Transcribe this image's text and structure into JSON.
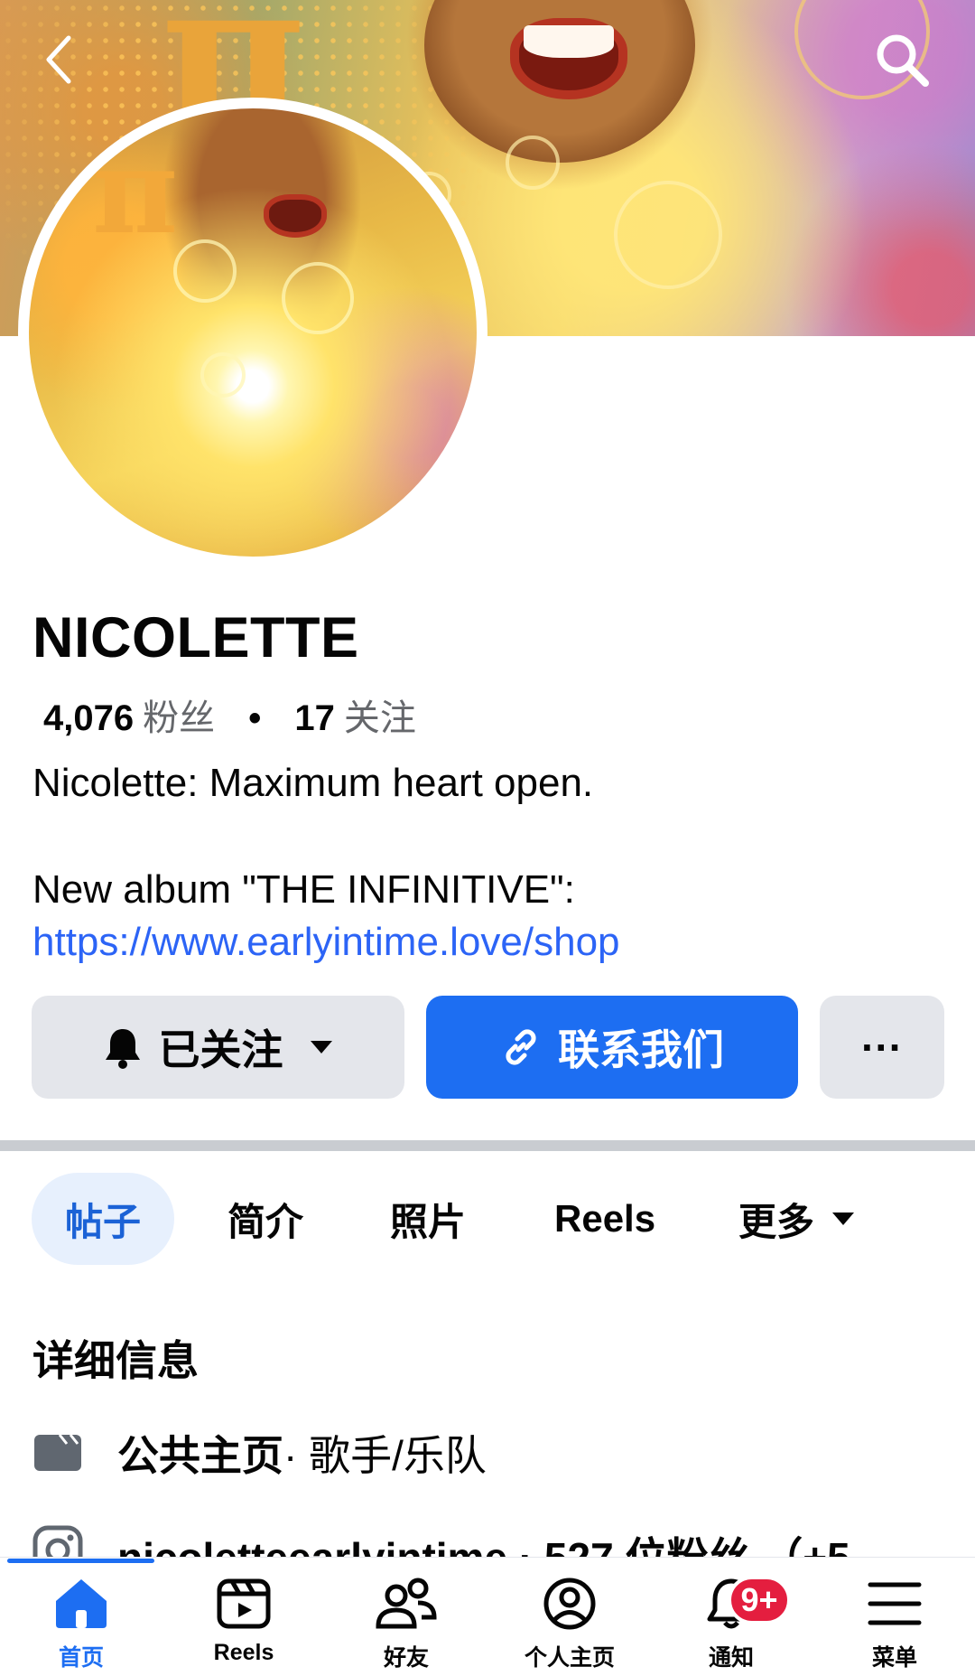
{
  "header": {
    "back_icon": "chevron-left-icon",
    "search_icon": "search-icon"
  },
  "profile": {
    "name": "NICOLETTE",
    "followers_count": "4,076",
    "followers_label": "粉丝",
    "following_count": "17",
    "following_label": "关注",
    "bio_line1": "Nicolette: Maximum heart open.",
    "bio_line2": "New album \"THE INFINITIVE\":",
    "bio_link": "https://www.earlyintime.love/shop"
  },
  "actions": {
    "follow_label": "已关注",
    "contact_label": "联系我们",
    "more_label": "···"
  },
  "tabs": [
    {
      "label": "帖子",
      "active": true
    },
    {
      "label": "简介",
      "active": false
    },
    {
      "label": "照片",
      "active": false
    },
    {
      "label": "Reels",
      "active": false
    },
    {
      "label": "更多",
      "active": false
    }
  ],
  "details": {
    "title": "详细信息",
    "page_type_label": "公共主页",
    "page_type_category": " · 歌手/乐队",
    "instagram_text": "nicoletteearlyintime · 527 位粉丝 （+5"
  },
  "bottom_nav": {
    "items": [
      {
        "label": "首页",
        "icon": "home-icon",
        "active": true
      },
      {
        "label": "Reels",
        "icon": "reels-icon",
        "active": false
      },
      {
        "label": "好友",
        "icon": "friends-icon",
        "active": false
      },
      {
        "label": "个人主页",
        "icon": "profile-icon",
        "active": false
      },
      {
        "label": "通知",
        "icon": "bell-icon",
        "active": false
      },
      {
        "label": "菜单",
        "icon": "menu-icon",
        "active": false
      }
    ],
    "notification_badge": "9+"
  },
  "colors": {
    "accent": "#1d6ef2",
    "link": "#2c64f6",
    "badge": "#e41e3f",
    "tab_active_bg": "#e7f0fd"
  }
}
